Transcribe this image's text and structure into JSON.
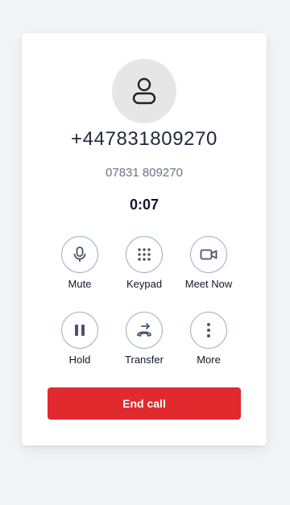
{
  "call": {
    "number": "+447831809270",
    "formatted_number": "07831 809270",
    "timer": "0:07"
  },
  "controls": [
    {
      "label": "Mute",
      "icon": "microphone-icon"
    },
    {
      "label": "Keypad",
      "icon": "keypad-icon"
    },
    {
      "label": "Meet Now",
      "icon": "video-camera-icon"
    },
    {
      "label": "Hold",
      "icon": "pause-icon"
    },
    {
      "label": "Transfer",
      "icon": "transfer-icon"
    },
    {
      "label": "More",
      "icon": "more-vertical-icon"
    }
  ],
  "end_call": {
    "label": "End call",
    "color": "#e02a2e"
  },
  "colors": {
    "border": "#9fb0c6",
    "icon": "#475569"
  }
}
